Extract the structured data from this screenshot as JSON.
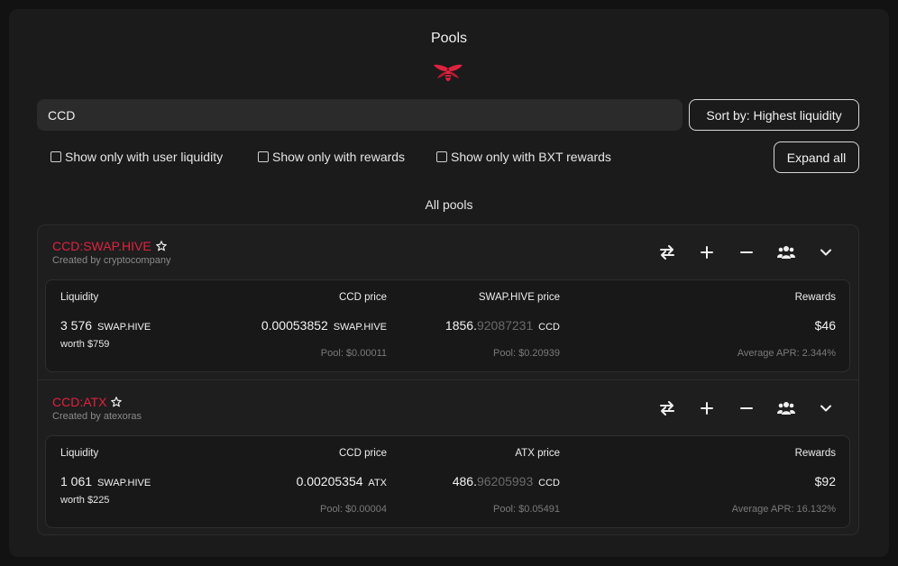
{
  "page": {
    "title": "Pools",
    "brand_color": "#e0223f"
  },
  "search": {
    "value": "CCD"
  },
  "sort": {
    "label": "Sort by: Highest liquidity"
  },
  "filters": [
    {
      "label": "Show only with user liquidity",
      "checked": false
    },
    {
      "label": "Show only with rewards",
      "checked": false
    },
    {
      "label": "Show only with BXT rewards",
      "checked": false
    }
  ],
  "expand_all_label": "Expand all",
  "section_title": "All pools",
  "columns": {
    "liquidity": "Liquidity",
    "rewards": "Rewards"
  },
  "pools": [
    {
      "name": "CCD:SWAP.HIVE",
      "created_by": "Created by cryptocompany",
      "price1_header": "CCD price",
      "price2_header": "SWAP.HIVE price",
      "liquidity_value": "3 576",
      "liquidity_unit": "SWAP.HIVE",
      "worth": "worth $759",
      "price1_value": "0.00053852",
      "price1_unit": "SWAP.HIVE",
      "price1_pool": "Pool: $0.00011",
      "price2_main": "1856.",
      "price2_dim": "92087231",
      "price2_unit": "CCD",
      "price2_pool": "Pool: $0.20939",
      "rewards_value": "$46",
      "apr": "Average APR: 2.344%"
    },
    {
      "name": "CCD:ATX",
      "created_by": "Created by atexoras",
      "price1_header": "CCD price",
      "price2_header": "ATX price",
      "liquidity_value": "1 061",
      "liquidity_unit": "SWAP.HIVE",
      "worth": "worth $225",
      "price1_value": "0.00205354",
      "price1_unit": "ATX",
      "price1_pool": "Pool: $0.00004",
      "price2_main": "486.",
      "price2_dim": "96205993",
      "price2_unit": "CCD",
      "price2_pool": "Pool: $0.05491",
      "rewards_value": "$92",
      "apr": "Average APR: 16.132%"
    }
  ],
  "icons": [
    "swap-icon",
    "plus-icon",
    "minus-icon",
    "users-icon",
    "chevron-down-icon",
    "star-icon",
    "bee-logo"
  ]
}
